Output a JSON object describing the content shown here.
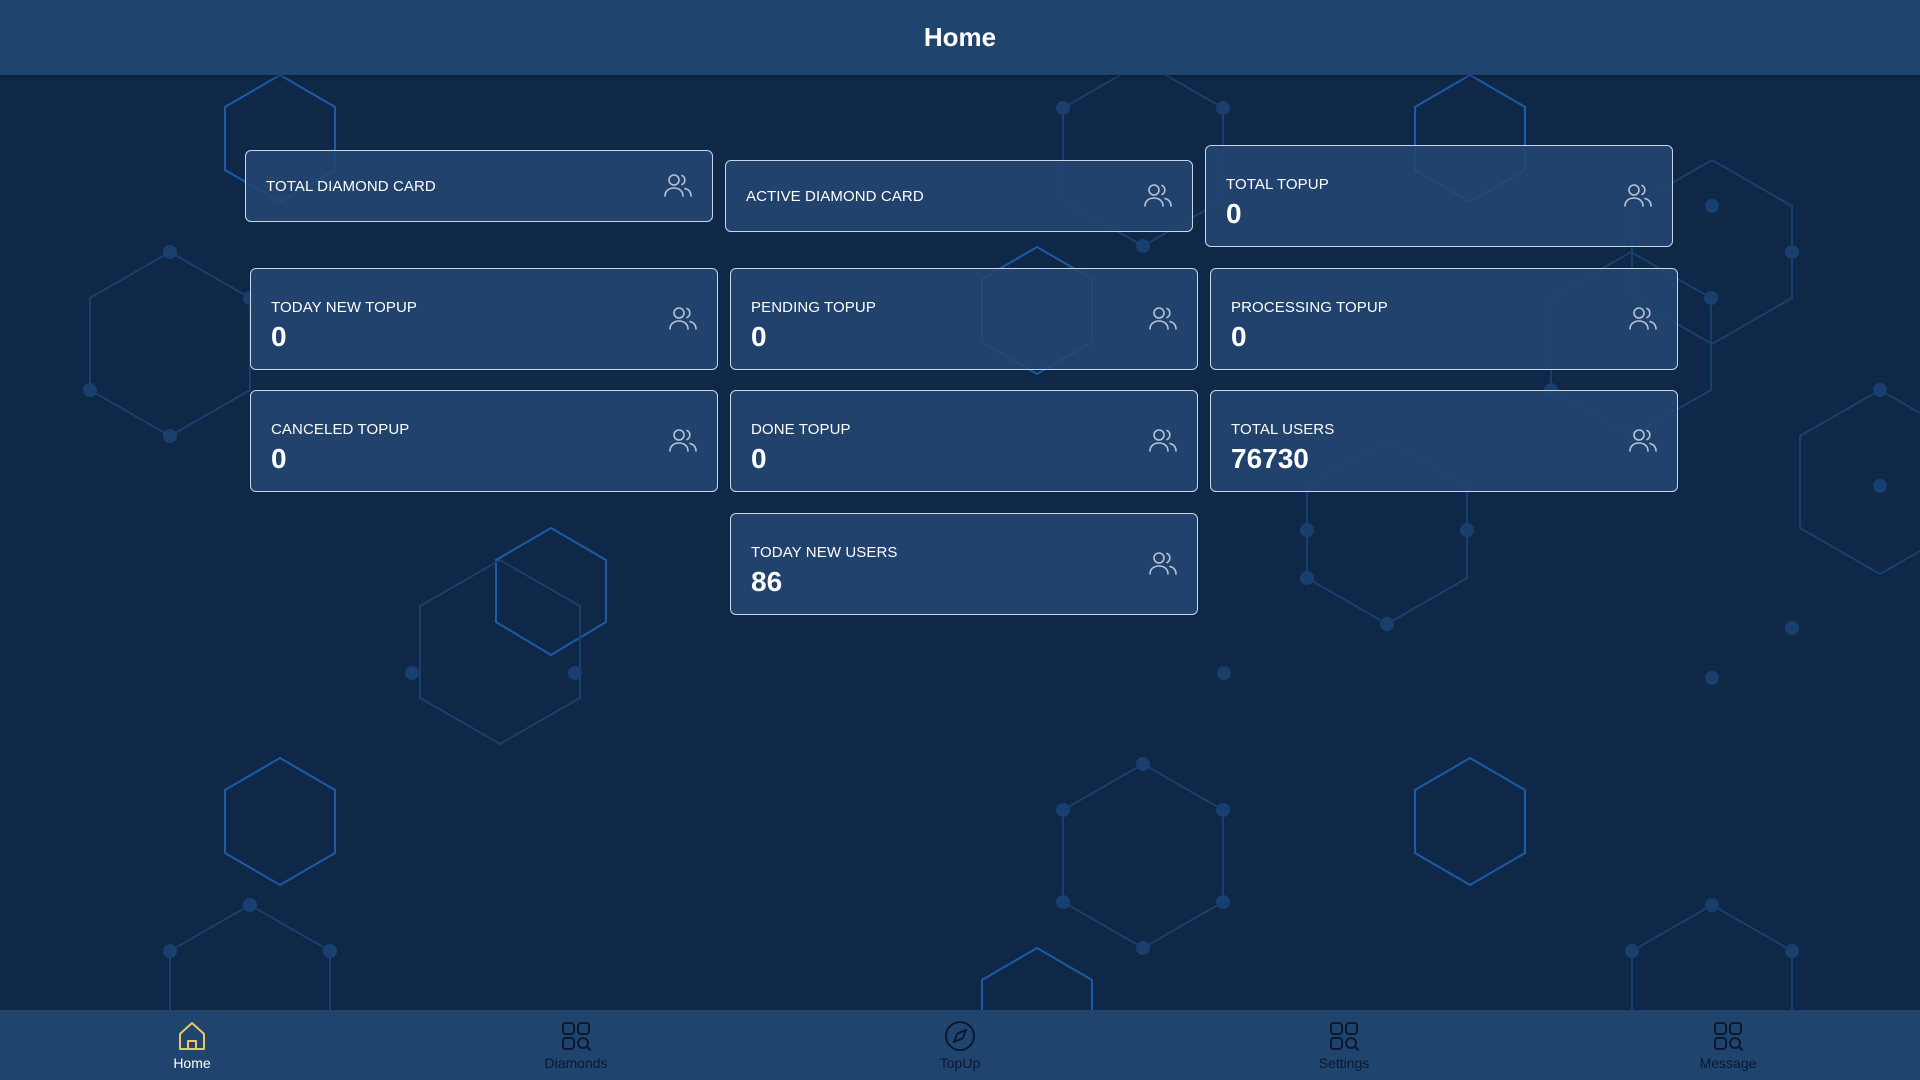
{
  "header": {
    "title": "Home"
  },
  "cards": {
    "total_diamond_card": {
      "label": "TOTAL DIAMOND CARD",
      "icon": "users-icon"
    },
    "active_diamond_card": {
      "label": "ACTIVE DIAMOND CARD",
      "icon": "users-icon"
    },
    "total_topup": {
      "label": "TOTAL TOPUP",
      "value": "0",
      "icon": "users-icon"
    },
    "today_new_topup": {
      "label": "TODAY NEW TOPUP",
      "value": "0",
      "icon": "users-icon"
    },
    "pending_topup": {
      "label": "PENDING TOPUP",
      "value": "0",
      "icon": "users-icon"
    },
    "processing_topup": {
      "label": "PROCESSING TOPUP",
      "value": "0",
      "icon": "users-icon"
    },
    "canceled_topup": {
      "label": "CANCELED TOPUP",
      "value": "0",
      "icon": "users-icon"
    },
    "done_topup": {
      "label": "DONE TOPUP",
      "value": "0",
      "icon": "users-icon"
    },
    "total_users": {
      "label": "TOTAL USERS",
      "value": "76730",
      "icon": "users-icon"
    },
    "today_new_users": {
      "label": "TODAY NEW USERS",
      "value": "86",
      "icon": "users-icon"
    }
  },
  "bottom_nav": {
    "active": "Home",
    "items": [
      {
        "label": "Home",
        "icon": "home-icon"
      },
      {
        "label": "Diamonds",
        "icon": "grid-search-icon"
      },
      {
        "label": "TopUp",
        "icon": "compass-icon"
      },
      {
        "label": "Settings",
        "icon": "grid-search-icon"
      },
      {
        "label": "Message",
        "icon": "grid-search-icon"
      }
    ]
  },
  "colors": {
    "background": "#0f2847",
    "header": "#1f446e",
    "card": "#234673",
    "card_border": "#c8d6ea",
    "hex_pattern": "#1d5aa8",
    "active_nav_icon": "#e8c56a",
    "nav_label": "#0b1830"
  }
}
